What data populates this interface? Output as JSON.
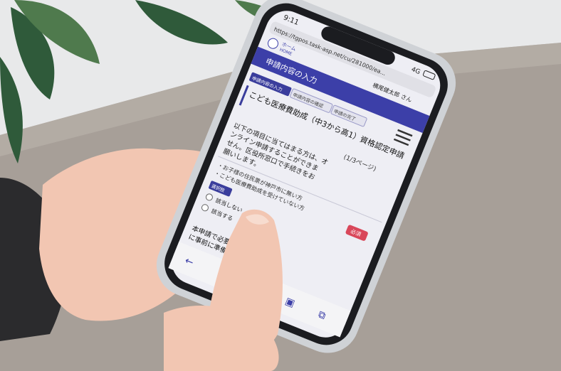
{
  "colors": {
    "wall": "#e8e9ea",
    "wall_shadow": "#d9dadb",
    "table": "#a79f98",
    "table_light": "#bdb6ae",
    "leaf": "#2f5a3a",
    "leaf_light": "#4f7a4d",
    "sweater": "#2b2b2d",
    "skin": "#f2c6b2",
    "skin_shadow": "#d99f8a",
    "phone_case": "#cfd2d6",
    "phone_body": "#1b1c20",
    "screen_bg": "#eeeef4",
    "header_blue": "#3c3fa8",
    "accent_blue": "#3a3d9c",
    "badge_red": "#d9475a"
  },
  "phone": {
    "status_time": "9:11",
    "status_net": "4G",
    "url": "https://tgpos.task-asp.net/cu/281000/ea...",
    "home_label": "ホーム",
    "home_sub": "HOME",
    "user_name": "横尾健太郎 さん",
    "header_title": "申請内容の入力",
    "steps": [
      "申請内容の入力",
      "申請内容の確認",
      "申請の完了"
    ],
    "form_title": "こども医療費助成（中3から高1）資格認定申請",
    "page_indicator": "(1/3ページ)",
    "intro_lines": [
      "以下の項目に当てはまる方は、オ",
      "ンライン申請することができま",
      "せん。区役所窓口で手続きをお",
      "願いします。"
    ],
    "condition_lines": [
      "・お子様の住民票が神戸市に無い方",
      "・こども医療費助成を受けていない方"
    ],
    "required_label": "必須",
    "select_label": "選択肢",
    "options": [
      "該当しない",
      "該当する"
    ],
    "footer_lines": [
      "本申請で必要な添付書類を確",
      "に事前に準備をしたうえで申請"
    ]
  }
}
